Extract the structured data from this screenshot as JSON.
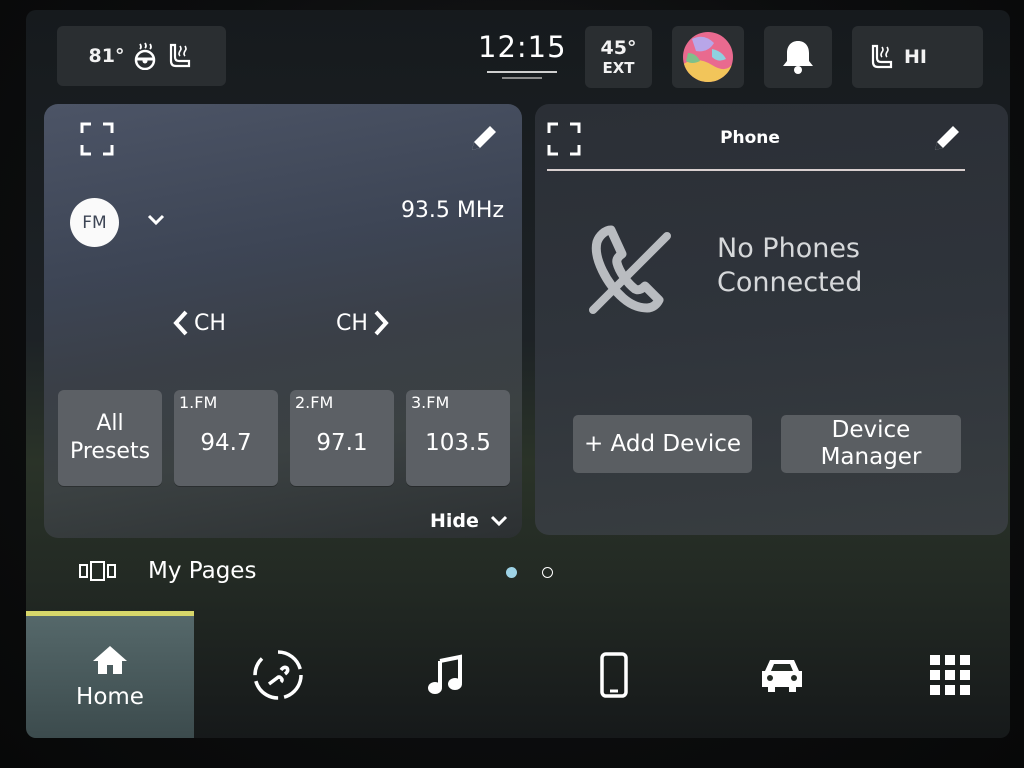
{
  "status_bar": {
    "cabin_temp": "81°",
    "time": "12:15",
    "ext_temp": "45°",
    "ext_label": "EXT",
    "seat_heat_level": "HI"
  },
  "radio": {
    "band_badge": "FM",
    "frequency": "93.5 MHz",
    "ch_prev_label": "CH",
    "ch_next_label": "CH",
    "all_presets_label": "All\nPresets",
    "presets": [
      {
        "num": "1.FM",
        "freq": "94.7"
      },
      {
        "num": "2.FM",
        "freq": "97.1"
      },
      {
        "num": "3.FM",
        "freq": "103.5"
      }
    ],
    "hide_label": "Hide"
  },
  "phone": {
    "title": "Phone",
    "status": "No Phones\nConnected",
    "add_device_label": "+ Add Device",
    "device_manager_label": "Device\nManager"
  },
  "my_pages": {
    "label": "My Pages",
    "page_count": 2,
    "active_page_index": 0
  },
  "nav": {
    "home_label": "Home",
    "items": [
      "home-icon",
      "nav-map-icon",
      "music-note-icon",
      "phone-icon",
      "car-icon",
      "apps-grid-icon"
    ]
  },
  "colors": {
    "active_tab_accent": "#d7d76a",
    "active_dot": "#9ed3e6"
  }
}
